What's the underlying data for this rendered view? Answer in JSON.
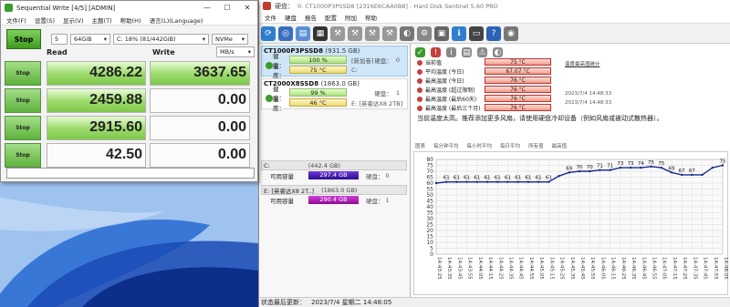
{
  "cdm": {
    "title": "Sequential Write [4/5] [ADMIN]",
    "menu": [
      "文件(F)",
      "设置(S)",
      "显示(V)",
      "主题(T)",
      "帮助(H)",
      "语言(L)(Language)"
    ],
    "stop_all": "Stop",
    "count": "5",
    "size": "64GiB",
    "drive": "C: 18% (81/442GiB)",
    "mode": "NVMe",
    "unit": "MB/s",
    "read_header": "Read",
    "write_header": "Write",
    "rows": [
      {
        "stop": "Stop",
        "read": "4286.22",
        "write": "3637.65"
      },
      {
        "stop": "Stop",
        "read": "2459.88",
        "write": "0.00"
      },
      {
        "stop": "Stop",
        "read": "2915.60",
        "write": "0.00"
      },
      {
        "stop": "Stop",
        "read": "42.50",
        "write": "0.00"
      }
    ]
  },
  "hds": {
    "title": "0. CT1000P3PSSD8 [2316E6CAA0B8] - Hard Disk Sentinel 5.60 PRO",
    "title_prefix": "硬盘：",
    "menu": [
      "文件",
      "硬盘",
      "报告",
      "配置",
      "附加",
      "帮助"
    ],
    "disks": [
      {
        "name": "CT1000P3PSSD8",
        "size": "(931.5 GB)",
        "health_label": "健康：",
        "health": "100 %",
        "health_note": "[新加卷]",
        "temp_label": "温度：",
        "temp": "75 °C",
        "drive": "C:",
        "disk_label": "硬盘：",
        "disk_no": "0"
      },
      {
        "name": "CT2000X8SSD8",
        "size": "(1863.0 GB)",
        "health_label": "健康：",
        "health": "99 %",
        "health_note": "",
        "temp_label": "温度：",
        "temp": "46 °C",
        "drive": "E: [英睿达X8 2TB]",
        "disk_label": "硬盘：",
        "disk_no": "1"
      }
    ],
    "partitions": [
      {
        "label": "C:",
        "size": "(442.4 GB)",
        "free_label": "可用容量",
        "free": "297.4 GB",
        "disk_label": "硬盘：",
        "disk_no": "0"
      },
      {
        "label": "E: [英睿达X8 2T..]",
        "size": "(1863.0 GB)",
        "free_label": "可用容量",
        "free": "290.4 GB",
        "disk_label": "硬盘：",
        "disk_no": "1"
      }
    ],
    "attributes": [
      {
        "label": "当前值",
        "value": "75 °C"
      },
      {
        "label": "平均温度 (今日)",
        "value": "67.07 °C"
      },
      {
        "label": "最高温度 (今日)",
        "value": "76 °C"
      },
      {
        "label": "最高温度 (超过限制)",
        "value": "76 °C"
      },
      {
        "label": "最高温度 (最后60天)",
        "value": "76 °C"
      },
      {
        "label": "最高温度 (最后三个月)",
        "value": "76 °C"
      }
    ],
    "side_link": "温度最高值统计",
    "side_dates": [
      "2023/7/4 14:48:33",
      "2023/7/4 14:48:33"
    ],
    "note": "当前温度太高。推荐添加更多风扇，请使用硬盘冷却设备（例如风扇或被动式散热器）。",
    "tabs": [
      "图表",
      "每分钟平均",
      "每小时平均",
      "每日平均",
      "所有值",
      "最高值"
    ],
    "footer_label": "状态最后更新：",
    "footer_time": "2023/7/4 星期二 14:48:05"
  },
  "chart_data": {
    "type": "line",
    "ylim": [
      0,
      80
    ],
    "yticks": [
      0,
      5,
      10,
      15,
      20,
      25,
      30,
      35,
      40,
      45,
      50,
      55,
      60,
      65,
      70,
      75,
      80
    ],
    "x": [
      "14:43:25",
      "14:43:35",
      "14:43:45",
      "14:43:55",
      "14:44:05",
      "14:44:15",
      "14:44:25",
      "14:44:35",
      "14:44:45",
      "14:44:55",
      "14:45:05",
      "14:45:15",
      "14:45:25",
      "14:45:35",
      "14:45:45",
      "14:45:55",
      "14:46:05",
      "14:46:15",
      "14:46:25",
      "14:46:35",
      "14:46:45",
      "14:46:55",
      "14:47:05",
      "14:47:15",
      "14:47:25",
      "14:47:35",
      "14:47:45",
      "14:47:55",
      "14:48:05"
    ],
    "values": [
      60,
      61,
      61,
      61,
      61,
      61,
      61,
      61,
      61,
      61,
      61,
      61,
      66,
      69,
      70,
      70,
      71,
      71,
      73,
      73,
      73,
      74,
      73,
      69,
      67,
      67,
      67,
      73,
      75
    ],
    "point_labels": [
      "",
      "61",
      "61",
      "61",
      "61",
      "61",
      "61",
      "61",
      "61",
      "61",
      "61",
      "61",
      "",
      "69",
      "70",
      "70",
      "71",
      "71",
      "73",
      "73",
      "74",
      "75",
      "75",
      "69",
      "67",
      "67",
      "",
      "",
      "75"
    ],
    "grid": true,
    "color": "#1a2a8a"
  }
}
